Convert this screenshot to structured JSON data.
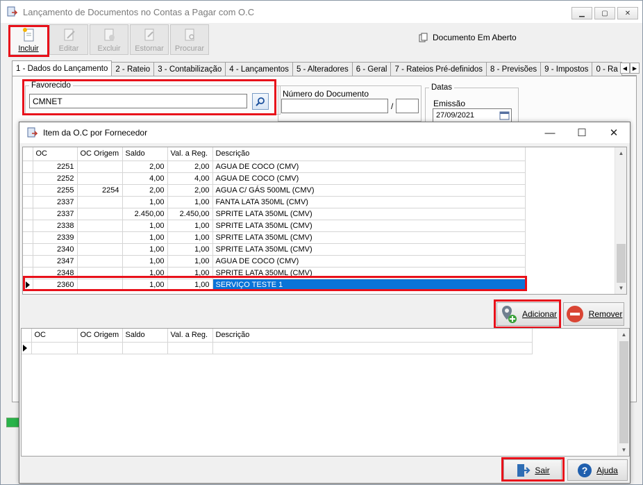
{
  "main_window": {
    "title": "Lançamento de Documentos no Contas a Pagar com O.C",
    "toolbar": [
      {
        "label": "Incluir",
        "enabled": true
      },
      {
        "label": "Editar",
        "enabled": false
      },
      {
        "label": "Excluir",
        "enabled": false
      },
      {
        "label": "Estornar",
        "enabled": false
      },
      {
        "label": "Procurar",
        "enabled": false
      }
    ],
    "status": "Documento Em Aberto",
    "tabs": [
      "1 - Dados do Lançamento",
      "2 - Rateio",
      "3 - Contabilização",
      "4 - Lançamentos",
      "5 - Alteradores",
      "6 - Geral",
      "7 - Rateios Pré-definidos",
      "8 - Previsões",
      "9 - Impostos",
      "0 - Ra"
    ],
    "favorecido": {
      "legend": "Favorecido",
      "value": "CMNET"
    },
    "numero_documento": {
      "label": "Número do Documento",
      "separator": "/"
    },
    "datas": {
      "legend": "Datas",
      "emissao_label": "Emissão",
      "emissao_value": "27/09/2021"
    }
  },
  "dialog": {
    "title": "Item da O.C por Fornecedor",
    "columns": [
      "OC",
      "OC Origem",
      "Saldo",
      "Val. a Reg.",
      "Descrição"
    ],
    "rows": [
      {
        "oc": "2251",
        "origem": "",
        "saldo": "2,00",
        "val": "2,00",
        "desc": "AGUA DE COCO (CMV)"
      },
      {
        "oc": "2252",
        "origem": "",
        "saldo": "4,00",
        "val": "4,00",
        "desc": "AGUA DE COCO (CMV)"
      },
      {
        "oc": "2255",
        "origem": "2254",
        "saldo": "2,00",
        "val": "2,00",
        "desc": "AGUA C/ GÁS 500ML (CMV)"
      },
      {
        "oc": "2337",
        "origem": "",
        "saldo": "1,00",
        "val": "1,00",
        "desc": "FANTA LATA 350ML (CMV)"
      },
      {
        "oc": "2337",
        "origem": "",
        "saldo": "2.450,00",
        "val": "2.450,00",
        "desc": "SPRITE LATA 350ML (CMV)"
      },
      {
        "oc": "2338",
        "origem": "",
        "saldo": "1,00",
        "val": "1,00",
        "desc": "SPRITE LATA 350ML (CMV)"
      },
      {
        "oc": "2339",
        "origem": "",
        "saldo": "1,00",
        "val": "1,00",
        "desc": "SPRITE LATA 350ML (CMV)"
      },
      {
        "oc": "2340",
        "origem": "",
        "saldo": "1,00",
        "val": "1,00",
        "desc": "SPRITE LATA 350ML (CMV)"
      },
      {
        "oc": "2347",
        "origem": "",
        "saldo": "1,00",
        "val": "1,00",
        "desc": "AGUA DE COCO (CMV)"
      },
      {
        "oc": "2348",
        "origem": "",
        "saldo": "1,00",
        "val": "1,00",
        "desc": "SPRITE LATA 350ML (CMV)"
      },
      {
        "oc": "2360",
        "origem": "",
        "saldo": "1,00",
        "val": "1,00",
        "desc": "SERVIÇO TESTE 1",
        "selected": true
      }
    ],
    "add_button": "Adicionar",
    "remove_button": "Remover",
    "lower_columns": [
      "OC",
      "OC Origem",
      "Saldo",
      "Val. a Reg.",
      "Descrição"
    ],
    "exit_button": "Sair",
    "help_button": "Ajuda"
  }
}
